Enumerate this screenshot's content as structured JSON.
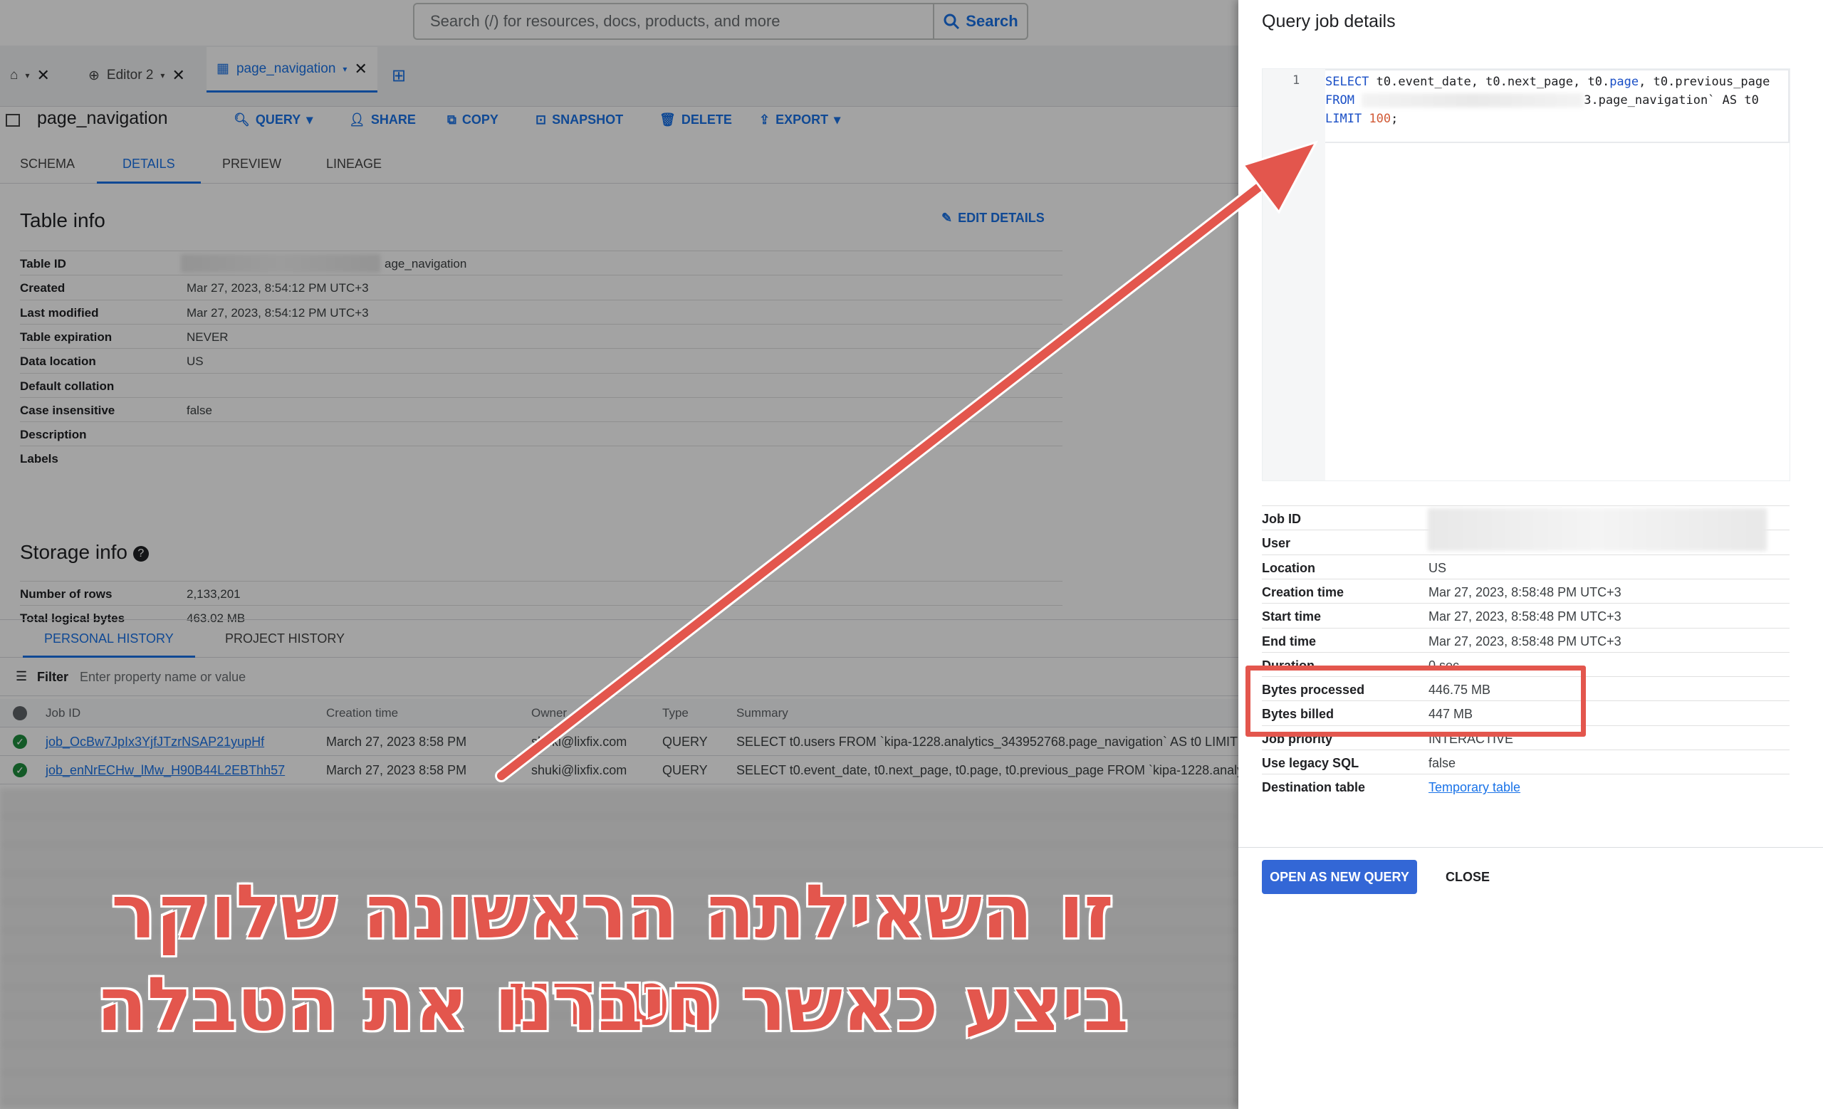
{
  "search": {
    "placeholder": "Search (/) for resources, docs, products, and more",
    "button_label": "Search"
  },
  "tabs": {
    "editor2_label": "Editor 2",
    "active_label": "page_navigation"
  },
  "table": {
    "title": "page_navigation"
  },
  "actions": {
    "query": "QUERY",
    "share": "SHARE",
    "copy": "COPY",
    "snapshot": "SNAPSHOT",
    "delete": "DELETE",
    "export": "EXPORT"
  },
  "subtabs": [
    "SCHEMA",
    "DETAILS",
    "PREVIEW",
    "LINEAGE"
  ],
  "table_info": {
    "title": "Table info",
    "edit_label": "EDIT DETAILS",
    "rows": [
      {
        "k": "Table ID",
        "v": "age_navigation"
      },
      {
        "k": "Created",
        "v": "Mar 27, 2023, 8:54:12 PM UTC+3"
      },
      {
        "k": "Last modified",
        "v": "Mar 27, 2023, 8:54:12 PM UTC+3"
      },
      {
        "k": "Table expiration",
        "v": "NEVER"
      },
      {
        "k": "Data location",
        "v": "US"
      },
      {
        "k": "Default collation",
        "v": ""
      },
      {
        "k": "Case insensitive",
        "v": "false"
      },
      {
        "k": "Description",
        "v": ""
      },
      {
        "k": "Labels",
        "v": ""
      }
    ]
  },
  "storage_info": {
    "title": "Storage info",
    "rows": [
      {
        "k": "Number of rows",
        "v": "2,133,201"
      },
      {
        "k": "Total logical bytes",
        "v": "463.02 MB"
      }
    ]
  },
  "history": {
    "tabs": [
      "PERSONAL HISTORY",
      "PROJECT HISTORY"
    ],
    "filter_label": "Filter",
    "filter_placeholder": "Enter property name or value",
    "columns": [
      "Job ID",
      "Creation time",
      "Owner",
      "Type",
      "Summary"
    ],
    "rows": [
      {
        "job_id": "job_OcBw7JpIx3YjfJTzrNSAP21yupHf",
        "created": "March 27, 2023 8:58 PM",
        "owner": "shuki@lixfix.com",
        "type": "QUERY",
        "summary": "SELECT t0.users FROM `kipa-1228.analytics_343952768.page_navigation` AS t0 LIMIT"
      },
      {
        "job_id": "job_enNrECHw_lMw_H90B44L2EBThh57",
        "created": "March 27, 2023 8:58 PM",
        "owner": "shuki@lixfix.com",
        "type": "QUERY",
        "summary": "SELECT t0.event_date, t0.next_page, t0.page, t0.previous_page FROM `kipa-1228.analy"
      }
    ]
  },
  "caption": {
    "line1": "זו השאילתה הראשונה שלוקר סטודיו",
    "line2": "ביצע כאשר חיברנו את הטבלה"
  },
  "panel": {
    "title": "Query job details",
    "code": {
      "line_number": "1",
      "l1_kw": "SELECT",
      "l1_rest": " t0.event_date, t0.next_page, t0.",
      "l1_page": "page",
      "l1_end": ", t0.previous_page",
      "l2_kw": "FROM",
      "l2_rest": "3.page_navigation` AS t0",
      "l3_kw": "LIMIT",
      "l3_num": "100",
      "l3_end": ";"
    },
    "rows": [
      {
        "k": "Job ID",
        "v": ""
      },
      {
        "k": "User",
        "v": ""
      },
      {
        "k": "Location",
        "v": "US"
      },
      {
        "k": "Creation time",
        "v": "Mar 27, 2023, 8:58:48 PM UTC+3"
      },
      {
        "k": "Start time",
        "v": "Mar 27, 2023, 8:58:48 PM UTC+3"
      },
      {
        "k": "End time",
        "v": "Mar 27, 2023, 8:58:48 PM UTC+3"
      },
      {
        "k": "Duration",
        "v": "0 sec"
      },
      {
        "k": "Bytes processed",
        "v": "446.75 MB"
      },
      {
        "k": "Bytes billed",
        "v": "447 MB"
      },
      {
        "k": "Job priority",
        "v": "INTERACTIVE"
      },
      {
        "k": "Use legacy SQL",
        "v": "false"
      },
      {
        "k": "Destination table",
        "v": "Temporary table"
      }
    ],
    "open_label": "OPEN AS NEW QUERY",
    "close_label": "CLOSE"
  },
  "colors": {
    "accent": "#1a73e8",
    "annotation": "#e3564d",
    "button": "#3367d6"
  }
}
